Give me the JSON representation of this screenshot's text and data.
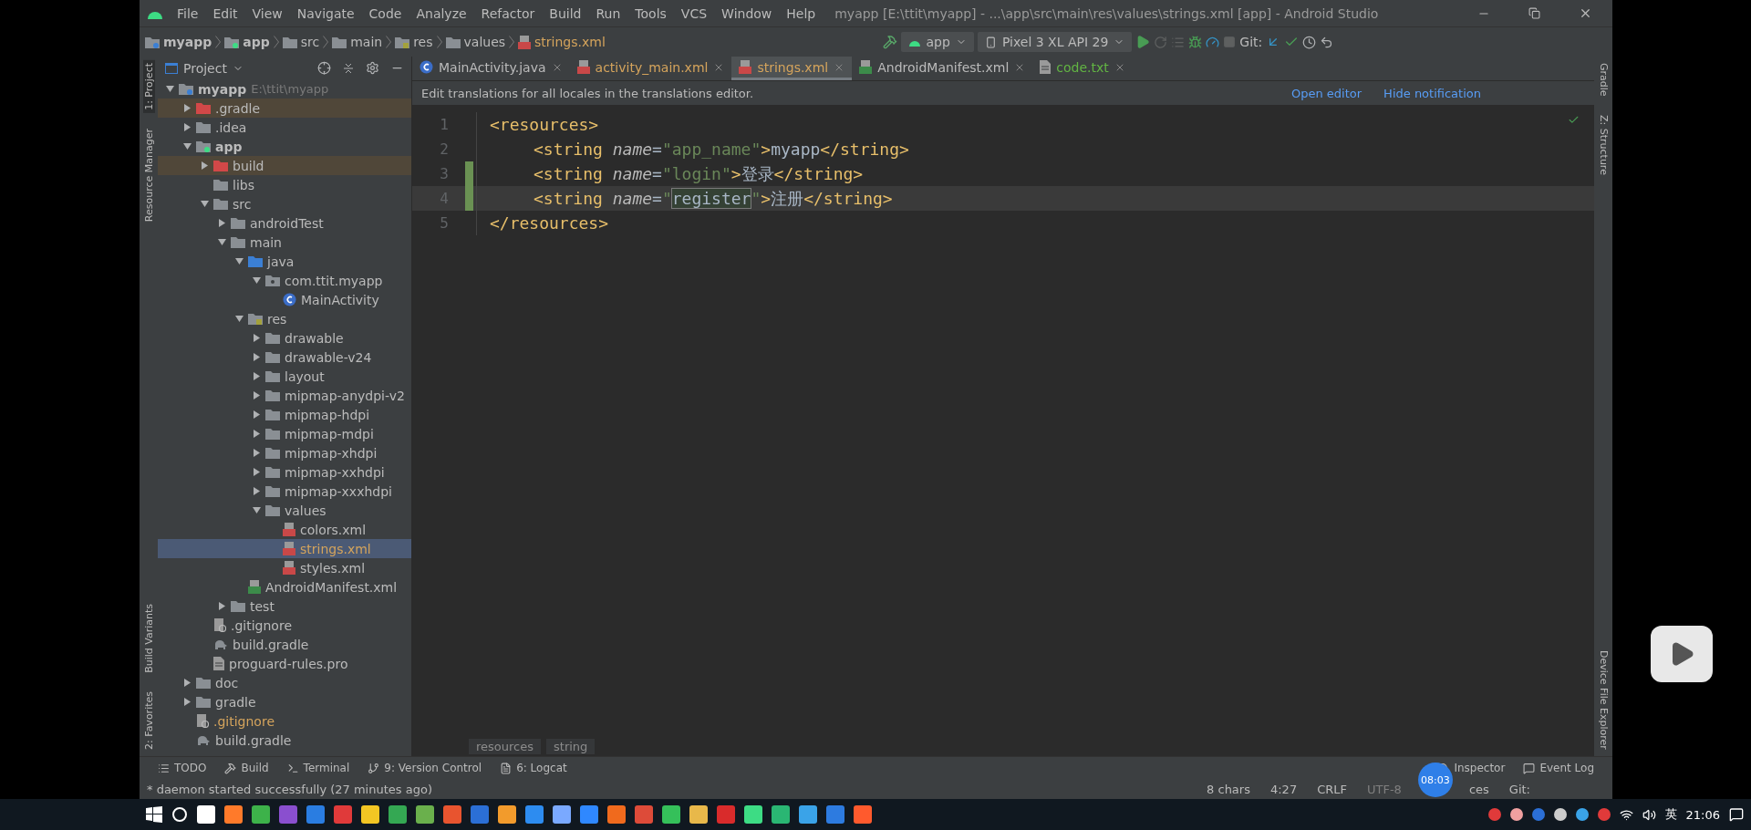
{
  "window": {
    "title": "myapp [E:\\ttit\\myapp] - ...\\app\\src\\main\\res\\values\\strings.xml [app] - Android Studio"
  },
  "menu": [
    "File",
    "Edit",
    "View",
    "Navigate",
    "Code",
    "Analyze",
    "Refactor",
    "Build",
    "Run",
    "Tools",
    "VCS",
    "Window",
    "Help"
  ],
  "breadcrumbs": [
    {
      "label": "myapp",
      "kind": "project"
    },
    {
      "label": "app",
      "kind": "module"
    },
    {
      "label": "src",
      "kind": "folder"
    },
    {
      "label": "main",
      "kind": "folder"
    },
    {
      "label": "res",
      "kind": "res"
    },
    {
      "label": "values",
      "kind": "folder"
    },
    {
      "label": "strings.xml",
      "kind": "xml"
    }
  ],
  "run_toolbar": {
    "configuration": "app",
    "device": "Pixel 3 XL API 29",
    "git_label": "Git:"
  },
  "left_strip": [
    {
      "label": "1: Project",
      "selected": true
    },
    {
      "label": "Resource Manager",
      "selected": false
    },
    {
      "label": "Build Variants",
      "selected": false
    },
    {
      "label": "2: Favorites",
      "selected": false
    }
  ],
  "right_strip": [
    "Gradle",
    "Z: Structure",
    "Device File Explorer"
  ],
  "project_panel": {
    "title": "Project",
    "tree": [
      {
        "label": "myapp",
        "path": "E:\\ttit\\myapp",
        "kind": "project",
        "expanded": true,
        "selected": false,
        "children": [
          {
            "label": ".gradle",
            "kind": "excluded-folder",
            "expanded": false,
            "selected": false
          },
          {
            "label": ".idea",
            "kind": "folder",
            "expanded": false,
            "selected": false
          },
          {
            "label": "app",
            "kind": "module",
            "expanded": true,
            "selected": false,
            "children": [
              {
                "label": "build",
                "kind": "excluded-folder",
                "expanded": false,
                "selected": false
              },
              {
                "label": "libs",
                "kind": "folder",
                "selected": false
              },
              {
                "label": "src",
                "kind": "folder",
                "expanded": true,
                "selected": false,
                "children": [
                  {
                    "label": "androidTest",
                    "kind": "folder",
                    "expanded": false,
                    "selected": false
                  },
                  {
                    "label": "main",
                    "kind": "folder",
                    "expanded": true,
                    "selected": false,
                    "children": [
                      {
                        "label": "java",
                        "kind": "source-folder",
                        "expanded": true,
                        "selected": false,
                        "children": [
                          {
                            "label": "com.ttit.myapp",
                            "kind": "package",
                            "expanded": true,
                            "selected": false,
                            "children": [
                              {
                                "label": "MainActivity",
                                "kind": "class",
                                "selected": false
                              }
                            ]
                          }
                        ]
                      },
                      {
                        "label": "res",
                        "kind": "res",
                        "expanded": true,
                        "selected": false,
                        "children": [
                          {
                            "label": "drawable",
                            "kind": "folder",
                            "expanded": false,
                            "selected": false
                          },
                          {
                            "label": "drawable-v24",
                            "kind": "folder",
                            "expanded": false,
                            "selected": false
                          },
                          {
                            "label": "layout",
                            "kind": "folder",
                            "expanded": false,
                            "selected": false
                          },
                          {
                            "label": "mipmap-anydpi-v2",
                            "kind": "folder",
                            "expanded": false,
                            "selected": false
                          },
                          {
                            "label": "mipmap-hdpi",
                            "kind": "folder",
                            "expanded": false,
                            "selected": false
                          },
                          {
                            "label": "mipmap-mdpi",
                            "kind": "folder",
                            "expanded": false,
                            "selected": false
                          },
                          {
                            "label": "mipmap-xhdpi",
                            "kind": "folder",
                            "expanded": false,
                            "selected": false
                          },
                          {
                            "label": "mipmap-xxhdpi",
                            "kind": "folder",
                            "expanded": false,
                            "selected": false
                          },
                          {
                            "label": "mipmap-xxxhdpi",
                            "kind": "folder",
                            "expanded": false,
                            "selected": false
                          },
                          {
                            "label": "values",
                            "kind": "folder",
                            "expanded": true,
                            "selected": false,
                            "children": [
                              {
                                "label": "colors.xml",
                                "kind": "xml",
                                "selected": false
                              },
                              {
                                "label": "strings.xml",
                                "kind": "xml",
                                "selected": true,
                                "modified": true
                              },
                              {
                                "label": "styles.xml",
                                "kind": "xml",
                                "selected": false
                              }
                            ]
                          }
                        ]
                      },
                      {
                        "label": "AndroidManifest.xml",
                        "kind": "manifest",
                        "selected": false
                      }
                    ]
                  },
                  {
                    "label": "test",
                    "kind": "folder",
                    "expanded": false,
                    "selected": false
                  }
                ]
              },
              {
                "label": ".gitignore",
                "kind": "gitignore",
                "selected": false
              },
              {
                "label": "build.gradle",
                "kind": "gradle",
                "selected": false
              },
              {
                "label": "proguard-rules.pro",
                "kind": "file",
                "selected": false
              }
            ]
          },
          {
            "label": "doc",
            "kind": "folder",
            "expanded": false,
            "selected": false
          },
          {
            "label": "gradle",
            "kind": "folder",
            "expanded": false,
            "selected": false
          },
          {
            "label": ".gitignore",
            "kind": "gitignore",
            "selected": false,
            "modified": true
          },
          {
            "label": "build.gradle",
            "kind": "gradle",
            "selected": false
          }
        ]
      }
    ]
  },
  "editor_tabs": [
    {
      "label": "MainActivity.java",
      "kind": "class",
      "color": "#bbbbbb",
      "selected": false
    },
    {
      "label": "activity_main.xml",
      "kind": "xml",
      "color": "#d5a45c",
      "selected": false
    },
    {
      "label": "strings.xml",
      "kind": "xml",
      "color": "#d5a45c",
      "selected": true
    },
    {
      "label": "AndroidManifest.xml",
      "kind": "manifest",
      "color": "#bbbbbb",
      "selected": false
    },
    {
      "label": "code.txt",
      "kind": "file",
      "color": "#62b543",
      "selected": false
    }
  ],
  "notification": {
    "text": "Edit translations for all locales in the translations editor.",
    "links": [
      "Open editor",
      "Hide notification"
    ]
  },
  "code_lines": [
    {
      "number": "1",
      "kind": "outer",
      "changed": false,
      "current": false,
      "tokens": [
        {
          "kind": "tag",
          "text": "<resources>"
        }
      ]
    },
    {
      "number": "2",
      "kind": "inner",
      "changed": false,
      "current": false,
      "tokens": [
        {
          "kind": "tag",
          "text": "<string "
        },
        {
          "kind": "attr",
          "text": "name"
        },
        {
          "kind": "punct",
          "text": "="
        },
        {
          "kind": "value",
          "text": "\"app_name\""
        },
        {
          "kind": "tag",
          "text": ">"
        },
        {
          "kind": "text",
          "text": "myapp"
        },
        {
          "kind": "tag",
          "text": "</string>"
        }
      ]
    },
    {
      "number": "3",
      "kind": "inner",
      "changed": true,
      "current": false,
      "tokens": [
        {
          "kind": "tag",
          "text": "<string "
        },
        {
          "kind": "attr",
          "text": "name"
        },
        {
          "kind": "punct",
          "text": "="
        },
        {
          "kind": "value",
          "text": "\"login\""
        },
        {
          "kind": "tag",
          "text": ">"
        },
        {
          "kind": "text",
          "text": "登录"
        },
        {
          "kind": "tag",
          "text": "</string>"
        }
      ]
    },
    {
      "number": "4",
      "kind": "inner",
      "changed": true,
      "current": true,
      "tokens": [
        {
          "kind": "tag",
          "text": "<string "
        },
        {
          "kind": "attr",
          "text": "name"
        },
        {
          "kind": "punct",
          "text": "="
        },
        {
          "kind": "value",
          "text": "\""
        },
        {
          "kind": "text",
          "text": "register",
          "highlighted": true
        },
        {
          "kind": "value",
          "text": "\""
        },
        {
          "kind": "tag",
          "text": ">"
        },
        {
          "kind": "text",
          "text": "注册"
        },
        {
          "kind": "tag",
          "text": "</string>"
        }
      ]
    },
    {
      "number": "5",
      "kind": "outer",
      "changed": false,
      "current": false,
      "tokens": [
        {
          "kind": "tag",
          "text": "</resources>"
        }
      ]
    }
  ],
  "editor_breadcrumbs": [
    "resources",
    "string"
  ],
  "tool_tabs": [
    {
      "label": "TODO",
      "kind": "list"
    },
    {
      "label": "Build",
      "kind": "hammer"
    },
    {
      "label": "Terminal",
      "kind": "terminal"
    },
    {
      "label": "9: Version Control",
      "kind": "vcs"
    },
    {
      "label": "6: Logcat",
      "kind": "logcat"
    }
  ],
  "tool_tabs_right": [
    {
      "label": "Inspector",
      "kind": "inspector"
    },
    {
      "label": "Event Log",
      "kind": "log"
    }
  ],
  "status_bar": {
    "message": "* daemon started successfully (27 minutes ago)",
    "items": [
      "8 chars",
      "4:27",
      "CRLF",
      "UTF-8",
      "ces",
      "Git:"
    ]
  },
  "player_overlay": {
    "time": "08:03"
  },
  "taskbar": {
    "apps": [
      {
        "color": "#ffffff"
      },
      {
        "color": "#ff7a2a"
      },
      {
        "color": "#3db24a"
      },
      {
        "color": "#8a4fcf"
      },
      {
        "color": "#2a7de1"
      },
      {
        "color": "#e03a3a"
      },
      {
        "color": "#f3c623"
      },
      {
        "color": "#34a853"
      },
      {
        "color": "#6ab04c"
      },
      {
        "color": "#e8542f"
      },
      {
        "color": "#2b6fd6"
      },
      {
        "color": "#f29b2c"
      },
      {
        "color": "#2d8cf0"
      },
      {
        "color": "#7aa9ff"
      },
      {
        "color": "#2f88ff"
      },
      {
        "color": "#f06a1d"
      },
      {
        "color": "#dd4b39"
      },
      {
        "color": "#35c05a"
      },
      {
        "color": "#e8b84a"
      },
      {
        "color": "#d92b2b"
      },
      {
        "color": "#3ddc84"
      },
      {
        "color": "#2ab673"
      },
      {
        "color": "#3aa3e8"
      },
      {
        "color": "#2d7be0"
      },
      {
        "color": "#ff5a2d"
      }
    ],
    "tray": [
      {
        "color": "#e03a3a"
      },
      {
        "color": "#f0a0a0"
      },
      {
        "color": "#2b6fd6"
      },
      {
        "color": "#cccccc"
      },
      {
        "color": "#3aa3e8"
      },
      {
        "color": "#e03a3a"
      }
    ],
    "ime": "英",
    "clock": "21:06"
  }
}
